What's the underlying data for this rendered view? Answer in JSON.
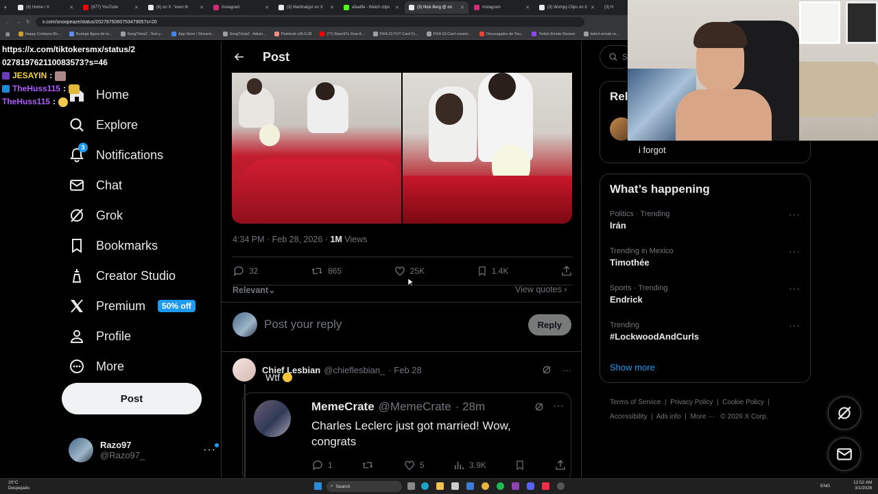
{
  "browser": {
    "tabs": [
      {
        "label": "(6) Home / X",
        "color": "#1d1d1d"
      },
      {
        "label": "(677) YouTube",
        "color": "#ff0000"
      },
      {
        "label": "(6) on X: \"even th",
        "color": "#1d1d1d"
      },
      {
        "label": "Instagram",
        "color": "#d62976"
      },
      {
        "label": "(3) Martinalguí on X",
        "color": "#1d1d1d"
      },
      {
        "label": "afaalife - Watch clips",
        "color": "#53fc18"
      },
      {
        "label": "(3) Nick Berg @ on",
        "color": "#1d1d1d"
      },
      {
        "label": "Instagram",
        "color": "#d62976"
      },
      {
        "label": "(3) Wompy Clips on X",
        "color": "#1d1d1d"
      },
      {
        "label": "(3) H",
        "color": "#1d1d1d"
      }
    ],
    "address": "x.com/snoopeaze/status/2027875060753479057s=20",
    "bookmarks": [
      "Happy Cristiano Ro...",
      "Buriego figura de tu...",
      "SongTrivia2 - Test y...",
      "App Store / Streami...",
      "SongTrivia2 - Adivin...",
      "Paletoob v26.0.28",
      "(77) Razo97s Zest-A...",
      "FIFA 23 FUT Card Cr...",
      "FIFA 23 Card creator...",
      "Descargador de You...",
      "Twitch Emote Resizer",
      "twitch emote re..."
    ]
  },
  "chat": {
    "url_line1": "https://x.com/tiktokersmx/status/2",
    "url_line2": "027819762110083573?s=46",
    "messages": [
      {
        "user": "JESAYIN",
        "sep": ":"
      },
      {
        "user": "TheHuss115",
        "sep": ":"
      },
      {
        "user": "TheHuss115",
        "sep": ":"
      }
    ]
  },
  "nav": {
    "items": [
      {
        "label": "Home",
        "icon": "home-icon"
      },
      {
        "label": "Explore",
        "icon": "search-icon"
      },
      {
        "label": "Notifications",
        "icon": "bell-icon",
        "badge": "3"
      },
      {
        "label": "Chat",
        "icon": "mail-icon"
      },
      {
        "label": "Grok",
        "icon": "grok-icon"
      },
      {
        "label": "Bookmarks",
        "icon": "bookmark-icon"
      },
      {
        "label": "Creator Studio",
        "icon": "creator-icon"
      },
      {
        "label": "Premium",
        "icon": "x-logo-icon",
        "badge": "50% off"
      },
      {
        "label": "Profile",
        "icon": "person-icon"
      },
      {
        "label": "More",
        "icon": "more-circle-icon"
      }
    ],
    "post_button": "Post",
    "profile": {
      "name": "Razo97",
      "handle": "@Razo97_"
    }
  },
  "post": {
    "header_title": "Post",
    "time": "4:34 PM · Feb 28, 2026 · ",
    "views_count": "1M",
    "views_label": " Views",
    "stats": {
      "replies": "32",
      "reposts": "865",
      "likes": "25K",
      "bookmarks": "1.4K"
    },
    "sort_label": "Relevant",
    "view_quotes": "View quotes",
    "reply_placeholder": "Post your reply",
    "reply_button": "Reply"
  },
  "comment": {
    "name": "Chief Lesbian",
    "handle": "@chieflesbian_",
    "date": "· Feb 28",
    "text": "Wtf",
    "quote": {
      "name": "MemeCrate",
      "handle": "@MemeCrate",
      "date": "· 28m",
      "text": "Charles Leclerc just got married! Wow, congrats",
      "replies": "1",
      "likes": "5",
      "views": "3.9K"
    }
  },
  "sidebar_right": {
    "search_placeholder": "Se",
    "relevant_title": "Rel",
    "relevant_snippet": "i forgot",
    "happening_title": "What’s happening",
    "trends": [
      {
        "category": "Politics · Trending",
        "title": "Irán"
      },
      {
        "category": "Trending in Mexico",
        "title": "Timothée"
      },
      {
        "category": "Sports · Trending",
        "title": "Endrick"
      },
      {
        "category": "Trending",
        "title": "#LockwoodAndCurls"
      }
    ],
    "show_more": "Show more",
    "footer_links": [
      "Terms of Service",
      "Privacy Policy",
      "Cookie Policy",
      "Accessibility",
      "Ads info",
      "More ···",
      "© 2026 X Corp."
    ]
  },
  "taskbar": {
    "weather_temp": "20°C",
    "weather_desc": "Despejado",
    "search": "Search",
    "lang": "ENG",
    "time": "12:52 AM",
    "date": "3/1/2026"
  },
  "colors": {
    "accent": "#1d9bf0",
    "background": "#000000",
    "border": "#2f3336",
    "muted": "#71767b"
  }
}
